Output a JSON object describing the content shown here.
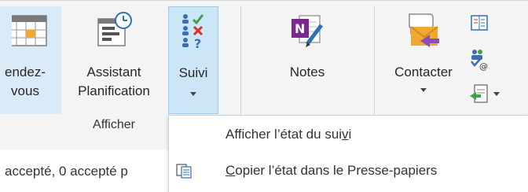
{
  "ribbon": {
    "buttons": [
      {
        "id": "rendez-vous",
        "label": "endez-\nvous",
        "icon": "calendar-grid-icon"
      },
      {
        "id": "assistant",
        "label": "Assistant\nPlanification",
        "icon": "scheduling-assistant-icon"
      },
      {
        "id": "suivi",
        "label": "Suivi",
        "icon": "tracking-icon"
      },
      {
        "id": "notes",
        "label": "Notes",
        "icon": "onenote-icon"
      },
      {
        "id": "contacter",
        "label": "Contacter",
        "icon": "contact-envelope-icon"
      }
    ],
    "group_label": "Afficher",
    "colors": {
      "selected_bg": "#cde6f7",
      "selected_border": "#9dc9ec",
      "onenote": "#7a2a8c",
      "contact_orange": "#f0a830"
    }
  },
  "menu": {
    "items": [
      {
        "label_before": "Afficher l’état du sui",
        "label_underlined": "v",
        "label_after": "i"
      },
      {
        "label_before": "",
        "label_underlined": "C",
        "label_after": "opier l’état dans le Presse-papiers",
        "icon": "copy-icon"
      }
    ]
  },
  "status": {
    "text": "accepté, 0 accepté p"
  }
}
